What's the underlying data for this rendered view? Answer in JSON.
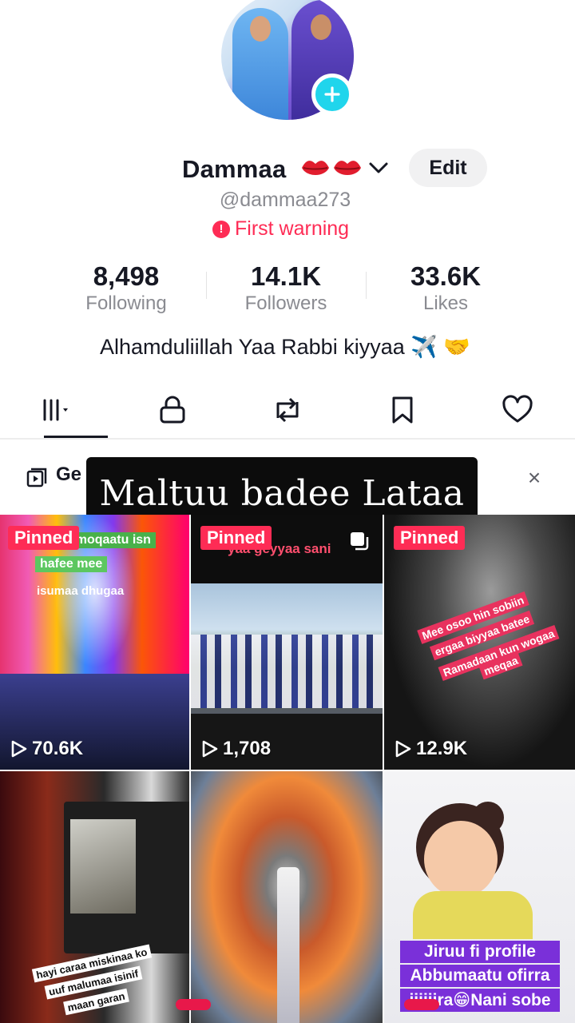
{
  "profile": {
    "display_name": "Dammaa",
    "handle": "@dammaa273",
    "warning": "First warning",
    "edit_label": "Edit",
    "bio": "Alhamduliillah Yaa Rabbi kiyyaa ✈️ 🤝"
  },
  "stats": {
    "following": {
      "value": "8,498",
      "label": "Following"
    },
    "followers": {
      "value": "14.1K",
      "label": "Followers"
    },
    "likes": {
      "value": "33.6K",
      "label": "Likes"
    }
  },
  "tabs": [
    {
      "name": "videos",
      "icon": "grid-icon",
      "active": true
    },
    {
      "name": "private",
      "icon": "lock-icon"
    },
    {
      "name": "reposts",
      "icon": "repost-icon"
    },
    {
      "name": "favorites",
      "icon": "bookmark-icon"
    },
    {
      "name": "liked",
      "icon": "heart-icon"
    }
  ],
  "banner": {
    "text": "Ge",
    "close_glyph": "×"
  },
  "caption": "Maltuu badee Lataa",
  "videos": [
    {
      "pinned": "Pinned",
      "views": "70.6K",
      "overlay": [
        "geyyaa moqaatu isn",
        "hafee mee",
        "isumaa dhugaa"
      ]
    },
    {
      "pinned": "Pinned",
      "views": "1,708",
      "overlay": [
        "yaa geyyaa sani"
      ]
    },
    {
      "pinned": "Pinned",
      "views": "12.9K",
      "overlay": [
        "Mee osoo hin sobiin",
        "ergaa biyyaa batee",
        "Ramadaan kun wogaa",
        "meqaa"
      ]
    },
    {
      "overlay": [
        "hayi caraa miskinaa ko",
        "uuf malumaa isinif",
        "maan garan"
      ]
    },
    {
      "overlay": []
    },
    {
      "overlay": [
        "Jiruu fi profile",
        "Abbumaatu ofirra",
        "iiiiiira😁Nani sobe"
      ]
    }
  ],
  "colors": {
    "accent": "#fe2c55",
    "add_button": "#20d5ec",
    "text": "#161823",
    "muted": "#8a8b91"
  }
}
